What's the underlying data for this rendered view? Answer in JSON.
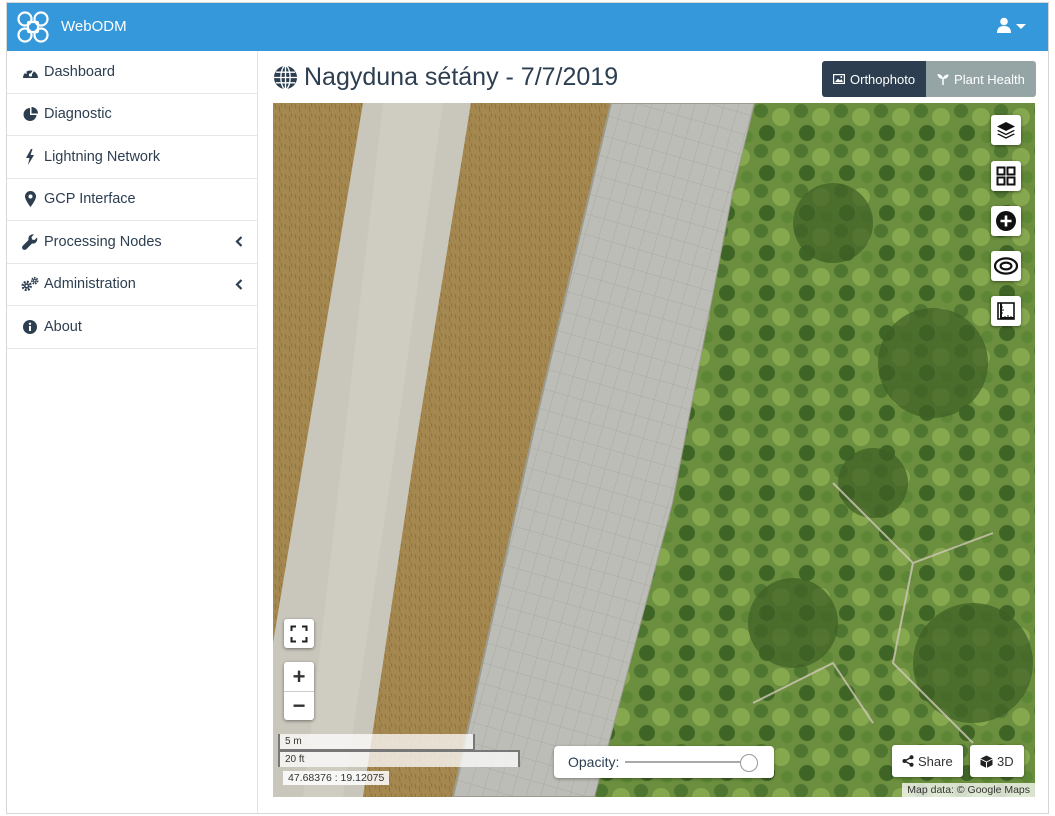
{
  "app": {
    "brand": "WebODM"
  },
  "sidebar": {
    "items": [
      {
        "label": "Dashboard",
        "icon": "dashboard-icon",
        "has_submenu": false
      },
      {
        "label": "Diagnostic",
        "icon": "pie-chart-icon",
        "has_submenu": false
      },
      {
        "label": "Lightning Network",
        "icon": "bolt-icon",
        "has_submenu": false
      },
      {
        "label": "GCP Interface",
        "icon": "map-marker-icon",
        "has_submenu": false
      },
      {
        "label": "Processing Nodes",
        "icon": "wrench-icon",
        "has_submenu": true
      },
      {
        "label": "Administration",
        "icon": "cogs-icon",
        "has_submenu": true
      },
      {
        "label": "About",
        "icon": "info-icon",
        "has_submenu": false
      }
    ]
  },
  "page": {
    "title": "Nagyduna sétány - 7/7/2019",
    "title_icon": "globe-icon"
  },
  "view_toggle": {
    "orthophoto_label": "Orthophoto",
    "plant_health_label": "Plant Health",
    "active": "Orthophoto"
  },
  "map": {
    "controls": [
      "layers-icon",
      "grid-icon",
      "add-circle-icon",
      "ring-icon",
      "ruler-icon"
    ],
    "scale_metric": "5 m",
    "scale_imperial": "20 ft",
    "coordinates": "47.68376 : 19.12075",
    "opacity_label": "Opacity:",
    "opacity_value": 0.95,
    "share_label": "Share",
    "threed_label": "3D",
    "attribution": "Map data: © Google Maps"
  },
  "colors": {
    "navbar": "#3498db",
    "primary_dark": "#2c3e50",
    "inactive_button": "#95a5a6"
  }
}
